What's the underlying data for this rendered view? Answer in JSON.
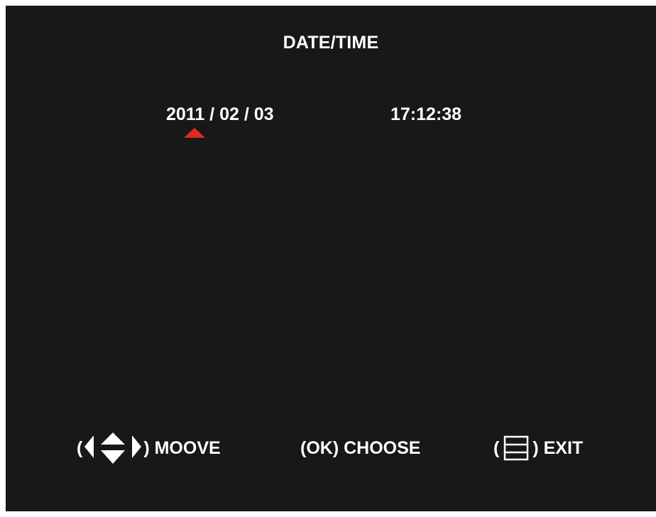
{
  "screen": {
    "title": "DATE/TIME",
    "date": "2011 / 02 / 03",
    "time": "17:12:38",
    "cursor_color": "#e02a1e",
    "background_color": "#181818",
    "text_color": "#ffffff"
  },
  "hints": {
    "move": {
      "open": "(",
      "close": ")",
      "label": "MOOVE",
      "icon": "arrow-keys-icon"
    },
    "choose": {
      "label": "(OK) CHOOSE"
    },
    "exit": {
      "open": "(",
      "close": ")",
      "label": "EXIT",
      "icon": "menu-icon"
    }
  }
}
